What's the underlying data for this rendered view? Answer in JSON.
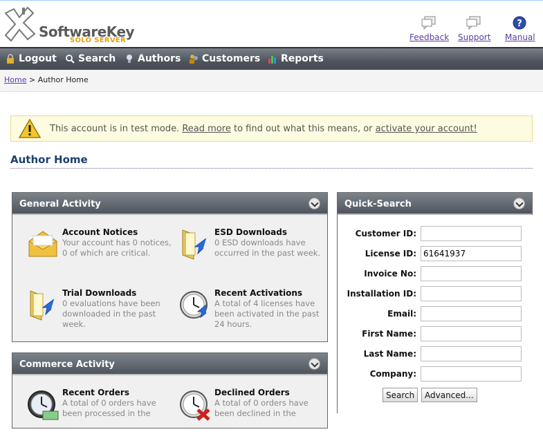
{
  "header": {
    "brand": "SoftwareKey",
    "sub_brand": "SOLO SERVER",
    "links": [
      {
        "label": "Feedback",
        "icon": "speech-bubble-icon"
      },
      {
        "label": "Support",
        "icon": "speech-bubble-icon"
      },
      {
        "label": "Manual",
        "icon": "help-icon"
      }
    ]
  },
  "nav": {
    "items": [
      {
        "label": "Logout",
        "icon": "lock-icon"
      },
      {
        "label": "Search",
        "icon": "search-icon"
      },
      {
        "label": "Authors",
        "icon": "lightbulb-icon"
      },
      {
        "label": "Customers",
        "icon": "people-icon"
      },
      {
        "label": "Reports",
        "icon": "bar-chart-icon"
      }
    ]
  },
  "breadcrumb": {
    "home": "Home",
    "separator": ">",
    "current": "Author Home"
  },
  "alert": {
    "text_before": "This account is in test mode.",
    "read_more": "Read more",
    "text_middle": "to find out what this means, or",
    "activate": "activate your account!"
  },
  "page_title": "Author Home",
  "general_activity": {
    "title": "General Activity",
    "items": [
      {
        "title": "Account Notices",
        "desc": "Your account has 0 notices, 0 of which are critical.",
        "icon": "envelope-icon"
      },
      {
        "title": "ESD Downloads",
        "desc": "0 ESD downloads have occurred in the past week.",
        "icon": "folder-download-icon"
      },
      {
        "title": "Trial Downloads",
        "desc": "0 evaluations have been downloaded in the past week.",
        "icon": "folder-download-icon"
      },
      {
        "title": "Recent Activations",
        "desc": "A total of 4 licenses have been activated in the past 24 hours.",
        "icon": "clock-icon"
      }
    ]
  },
  "commerce_activity": {
    "title": "Commerce Activity",
    "items": [
      {
        "title": "Recent Orders",
        "desc": "A total of 0 orders have been processed in the",
        "icon": "clock-money-icon"
      },
      {
        "title": "Declined Orders",
        "desc": "A total of 0 orders have been declined in the",
        "icon": "clock-declined-icon"
      }
    ]
  },
  "quick_search": {
    "title": "Quick-Search",
    "fields": [
      {
        "label": "Customer ID:",
        "value": ""
      },
      {
        "label": "License ID:",
        "value": "61641937"
      },
      {
        "label": "Invoice No:",
        "value": ""
      },
      {
        "label": "Installation ID:",
        "value": ""
      },
      {
        "label": "Email:",
        "value": ""
      },
      {
        "label": "First Name:",
        "value": ""
      },
      {
        "label": "Last Name:",
        "value": ""
      },
      {
        "label": "Company:",
        "value": ""
      }
    ],
    "search_button": "Search",
    "advanced_button": "Advanced..."
  }
}
